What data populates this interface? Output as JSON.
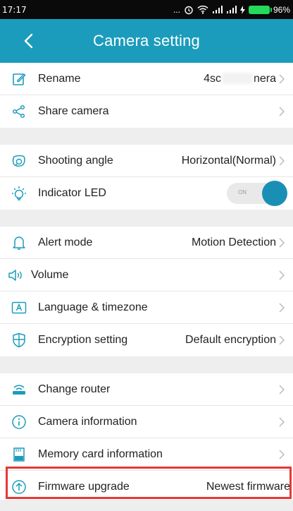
{
  "status_bar": {
    "time": "17:17",
    "dots": "...",
    "battery": "96%"
  },
  "header": {
    "title": "Camera setting",
    "back_icon": "chevron-left-icon",
    "color": "#1b9cbc"
  },
  "groups": [
    {
      "rows": [
        {
          "icon": "edit-icon",
          "label": "Rename",
          "value_start": "4sc",
          "value_end": "nera"
        },
        {
          "icon": "share-icon",
          "label": "Share camera"
        }
      ]
    },
    {
      "rows": [
        {
          "icon": "angle-icon",
          "label": "Shooting angle",
          "value": "Horizontal(Normal)"
        },
        {
          "icon": "led-icon",
          "label": "Indicator LED",
          "toggle_label": "ON",
          "toggle_on": true
        }
      ]
    },
    {
      "rows": [
        {
          "icon": "bell-icon",
          "label": "Alert mode",
          "value": "Motion Detection"
        },
        {
          "icon": "speaker-icon",
          "label": "Volume"
        },
        {
          "icon": "language-icon",
          "label": "Language & timezone"
        },
        {
          "icon": "shield-icon",
          "label": "Encryption setting",
          "value": "Default encryption"
        }
      ]
    },
    {
      "rows": [
        {
          "icon": "router-icon",
          "label": "Change router"
        },
        {
          "icon": "info-icon",
          "label": "Camera information"
        },
        {
          "icon": "sd-card-icon",
          "label": "Memory card information"
        },
        {
          "icon": "upgrade-icon",
          "label": "Firmware upgrade",
          "value": "Newest firmware"
        }
      ]
    }
  ],
  "highlight_color": "#e53935"
}
